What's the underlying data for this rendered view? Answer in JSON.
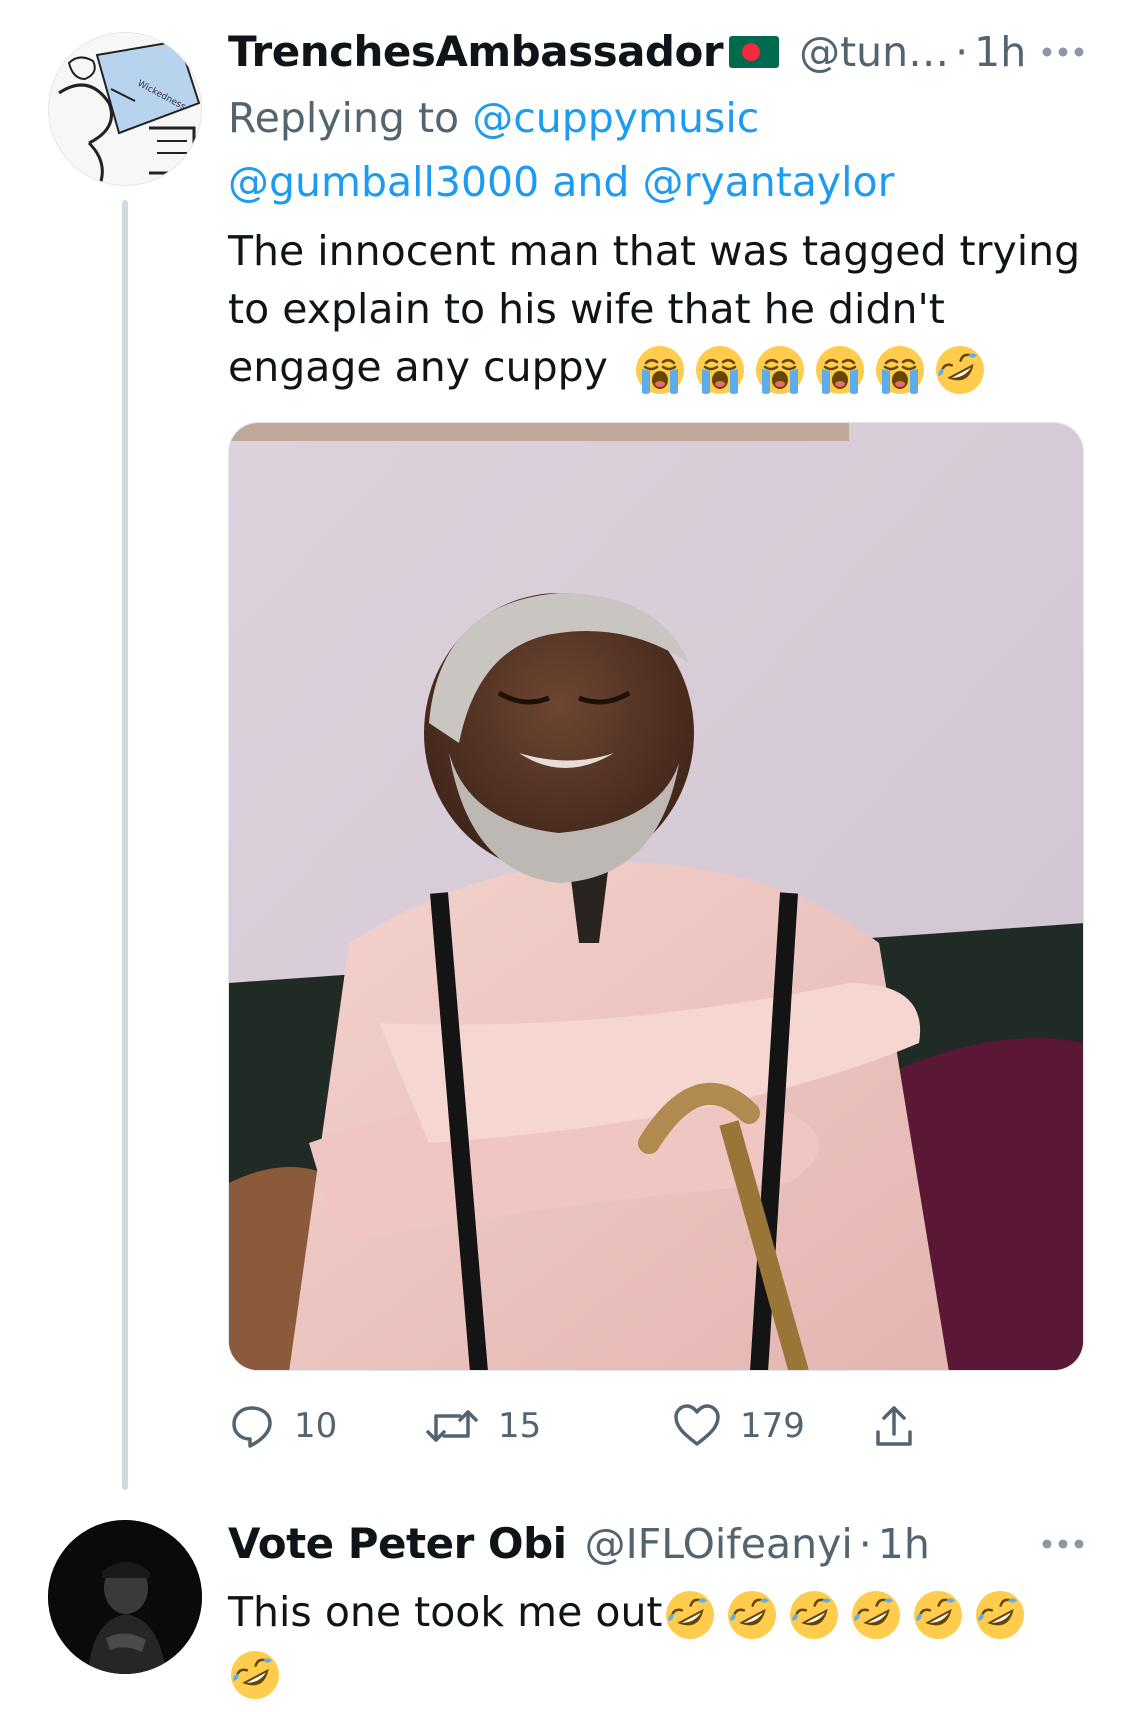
{
  "tweets": [
    {
      "display_name": "TrenchesAmbassador",
      "handle": "@tun…",
      "separator": "·",
      "time": "1h",
      "flag": "bangladesh-flag",
      "reply_prefix": "Replying to",
      "reply_mention_1": "@cuppymusic",
      "reply_mention_2": "@gumball3000",
      "reply_and": "and",
      "reply_mention_3": "@ryantaylor",
      "text": "The innocent man that was tagged trying to explain to his wife that he didn't engage any cuppy",
      "emojis": [
        "loudly-crying-face",
        "loudly-crying-face",
        "loudly-crying-face",
        "loudly-crying-face",
        "loudly-crying-face",
        "rolling-on-floor-laughing"
      ],
      "media": "photo-elderly-man-laughing-on-sofa",
      "actions": {
        "replies": "10",
        "retweets": "15",
        "likes": "179"
      }
    },
    {
      "display_name": "Vote Peter Obi",
      "handle": "@IFLOifeanyi",
      "separator": "·",
      "time": "1h",
      "text": "This one took me out",
      "emojis": [
        "rolling-on-floor-laughing",
        "rolling-on-floor-laughing",
        "rolling-on-floor-laughing",
        "rolling-on-floor-laughing",
        "rolling-on-floor-laughing",
        "rolling-on-floor-laughing",
        "rolling-on-floor-laughing"
      ]
    }
  ],
  "colors": {
    "link": "#1d9bf0",
    "secondary_text": "#536471",
    "primary_text": "#0f1419",
    "thread_line": "#cfd9de"
  }
}
